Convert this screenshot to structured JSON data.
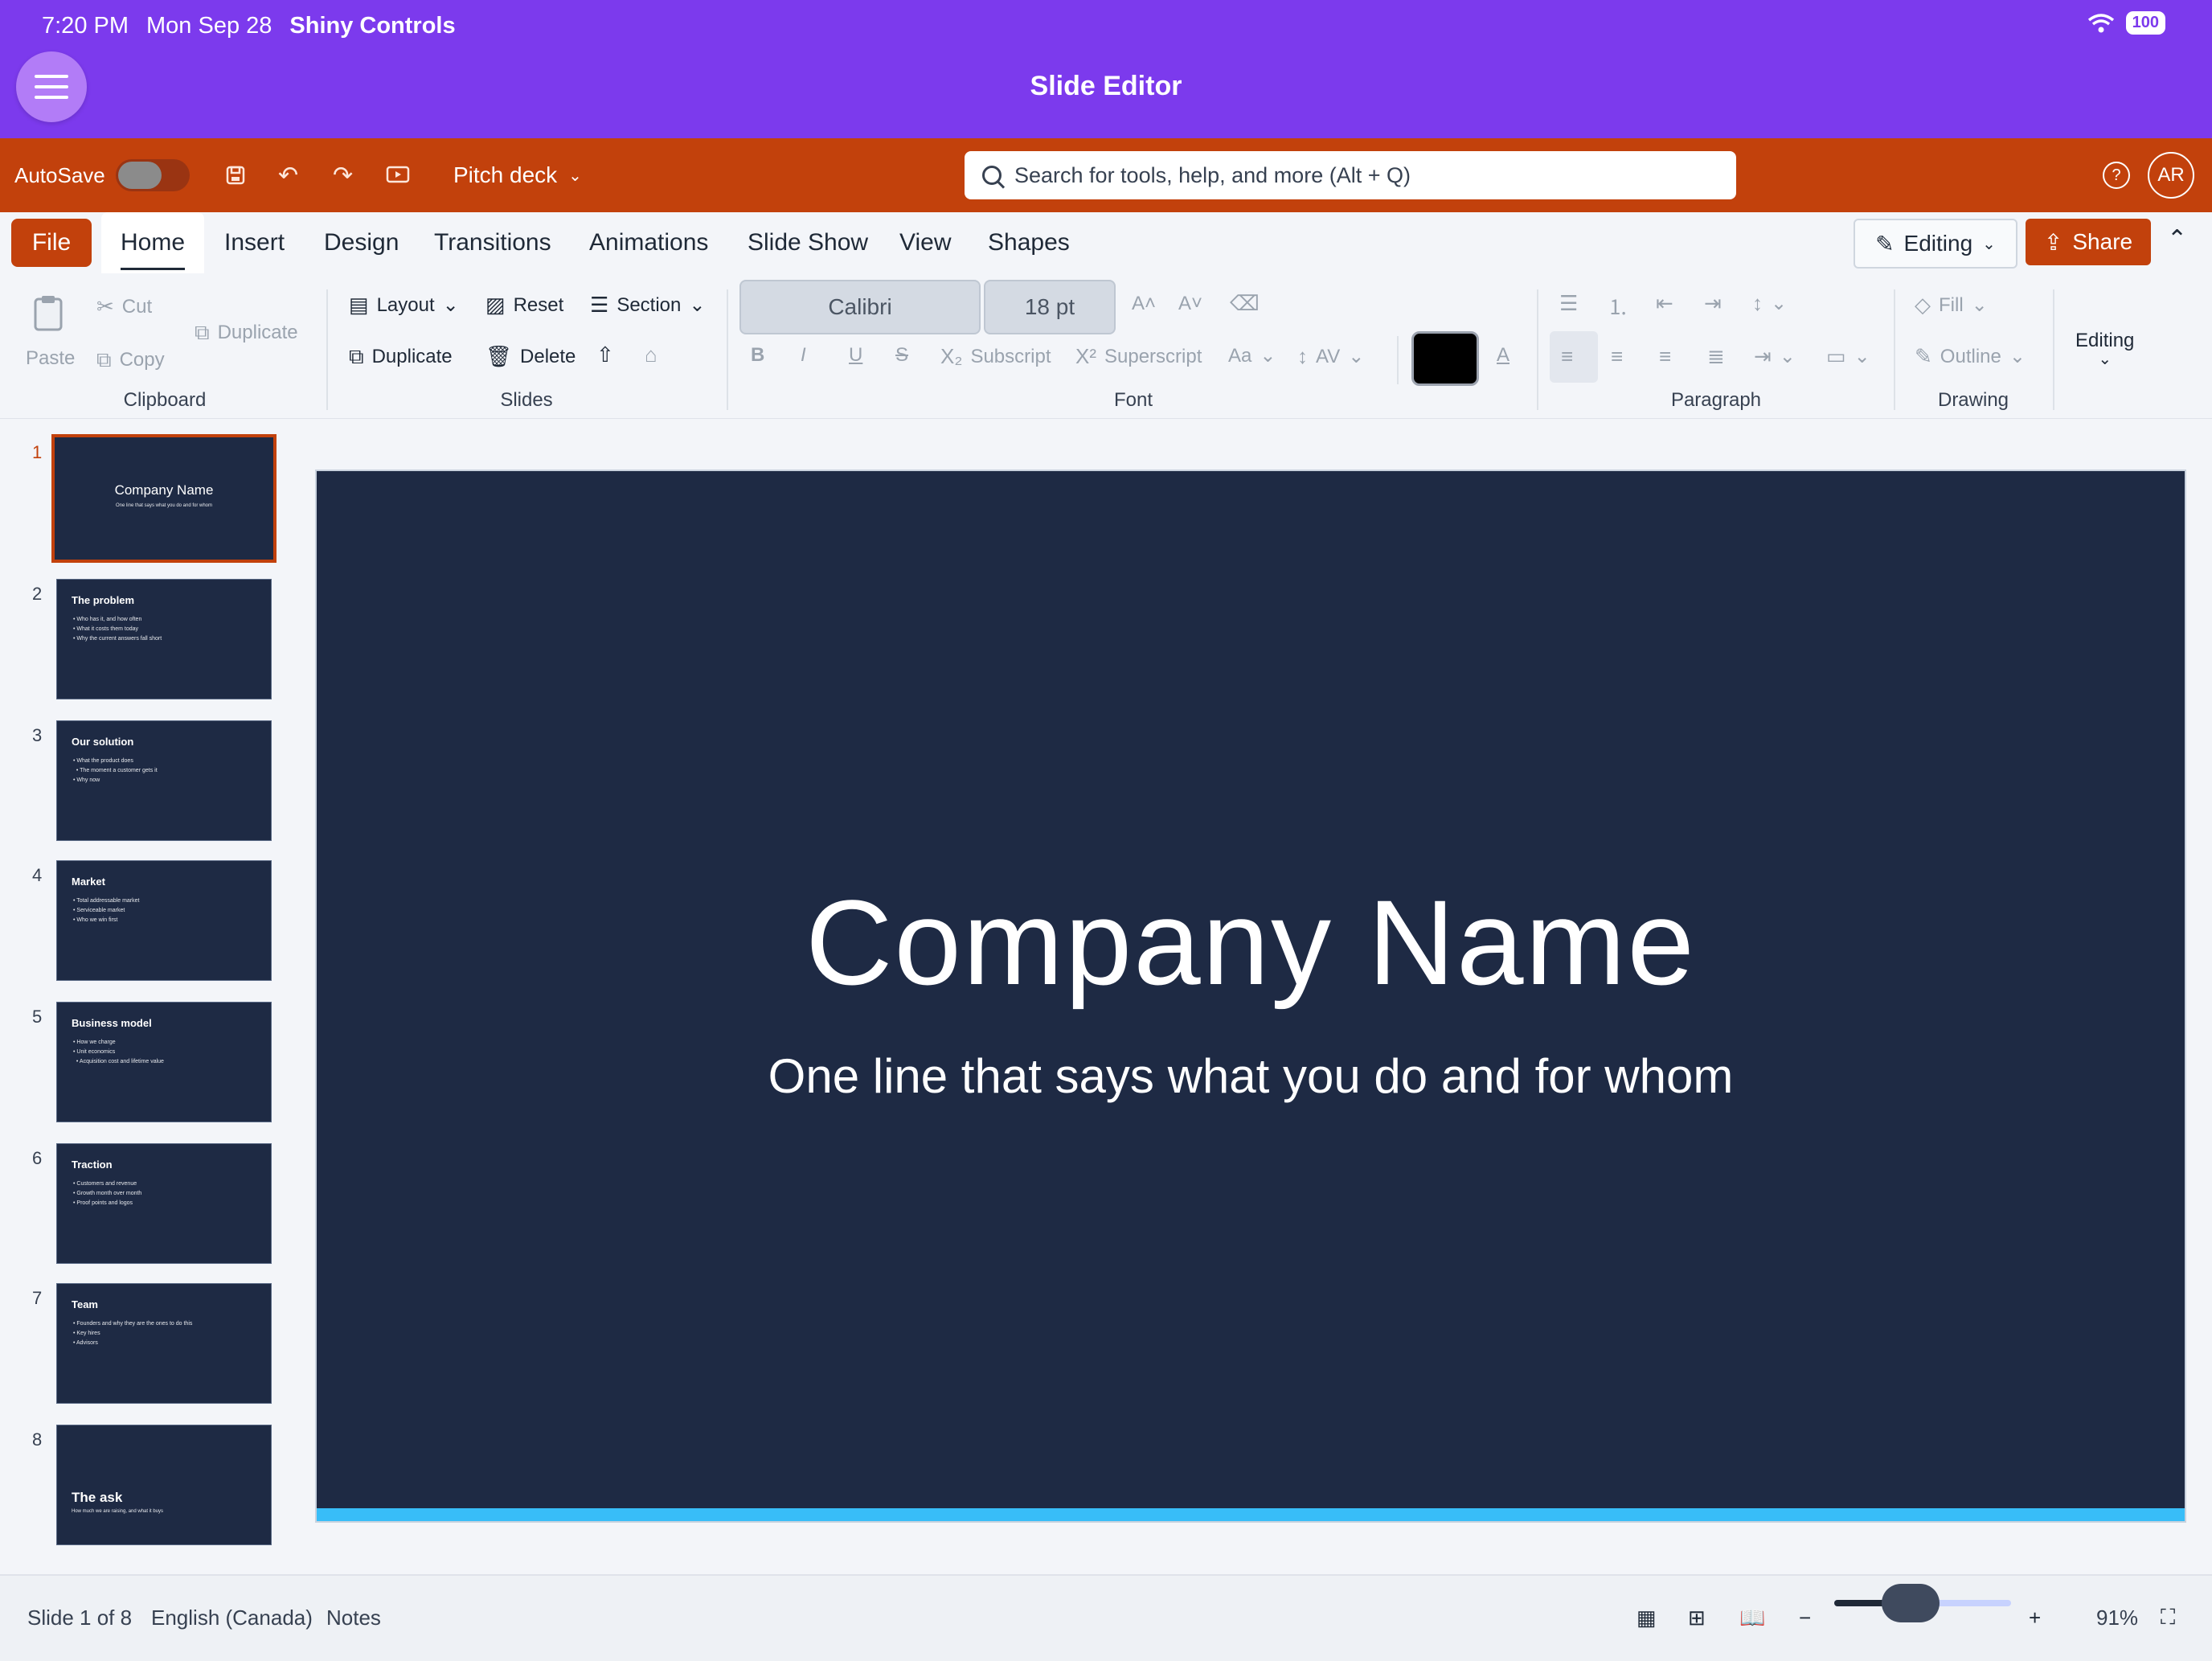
{
  "status_bar": {
    "time": "7:20 PM",
    "date": "Mon Sep 28",
    "app_name": "Shiny Controls",
    "battery": "100"
  },
  "app": {
    "title": "Slide Editor"
  },
  "titlebar": {
    "autosave_label": "AutoSave",
    "doc_name": "Pitch deck",
    "search_placeholder": "Search for tools, help, and more (Alt + Q)",
    "user_initials": "AR",
    "help_glyph": "?"
  },
  "tabs": {
    "file": "File",
    "items": [
      "Home",
      "Insert",
      "Design",
      "Transitions",
      "Animations",
      "Slide Show",
      "View",
      "Shapes"
    ],
    "editing": "Editing",
    "share": "Share"
  },
  "ribbon": {
    "clipboard": {
      "paste": "Paste",
      "cut": "Cut",
      "copy": "Copy",
      "duplicate": "Duplicate",
      "label": "Clipboard"
    },
    "slides": {
      "layout": "Layout",
      "reset": "Reset",
      "section": "Section",
      "duplicate": "Duplicate",
      "delete": "Delete",
      "label": "Slides"
    },
    "font": {
      "family": "Calibri",
      "size": "18 pt",
      "subscript": "Subscript",
      "superscript": "Superscript",
      "case": "Aa",
      "spacing": "AV",
      "label": "Font",
      "color": "#000000"
    },
    "paragraph": {
      "label": "Paragraph"
    },
    "drawing": {
      "fill": "Fill",
      "outline": "Outline",
      "label": "Drawing"
    },
    "editing": {
      "label": "Editing"
    }
  },
  "thumbnails": [
    {
      "num": "1",
      "title": "Company Name",
      "subtitle": "One line that says what you do and for whom"
    },
    {
      "num": "2",
      "title": "The problem",
      "bullets": [
        "• Who has it, and how often",
        "• What it costs them today",
        "• Why the current answers fall short"
      ]
    },
    {
      "num": "3",
      "title": "Our solution",
      "bullets": [
        "• What the product does",
        "  • The moment a customer gets it",
        "• Why now"
      ]
    },
    {
      "num": "4",
      "title": "Market",
      "bullets": [
        "• Total addressable market",
        "• Serviceable market",
        "• Who we win first"
      ]
    },
    {
      "num": "5",
      "title": "Business model",
      "bullets": [
        "• How we charge",
        "• Unit economics",
        "  • Acquisition cost and lifetime value"
      ]
    },
    {
      "num": "6",
      "title": "Traction",
      "bullets": [
        "• Customers and revenue",
        "• Growth month over month",
        "• Proof points and logos"
      ]
    },
    {
      "num": "7",
      "title": "Team",
      "bullets": [
        "• Founders and why they are the ones to do this",
        "• Key hires",
        "• Advisors"
      ]
    },
    {
      "num": "8",
      "title": "The ask",
      "subtitle": "How much we are raising, and what it buys"
    }
  ],
  "slide": {
    "title": "Company Name",
    "subtitle": "One line that says what you do and for whom",
    "background": "#1e2a44",
    "accent": "#38bdf8"
  },
  "statusbar": {
    "slide_position": "Slide 1 of 8",
    "language": "English (Canada)",
    "notes": "Notes",
    "zoom": "91%",
    "zoom_fraction": 0.4,
    "minus": "−",
    "plus": "+"
  },
  "colors": {
    "app_purple": "#7c3aed",
    "title_orange": "#c2410c",
    "selected_border": "#c2410c"
  }
}
